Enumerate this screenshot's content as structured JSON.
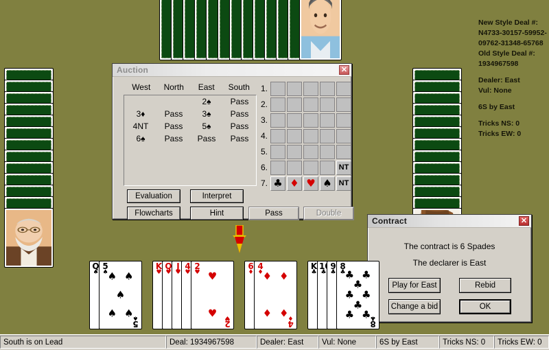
{
  "app": {
    "background_color": "#808040"
  },
  "info_panel": {
    "new_style_label": "New Style Deal #:",
    "new_style_line1": "N4733-30157-59952-",
    "new_style_line2": "09762-31348-65768",
    "old_style_label": "Old Style Deal #:",
    "old_style_value": "1934967598",
    "dealer": "Dealer: East",
    "vulnerability": "Vul: None",
    "contract": "6S by East",
    "tricks_ns": "Tricks NS: 0",
    "tricks_ew": "Tricks EW: 0"
  },
  "auction_dialog": {
    "title": "Auction",
    "close_label": "✕",
    "headers": [
      "West",
      "North",
      "East",
      "South"
    ],
    "bids": [
      [
        "",
        "",
        "2♠",
        "Pass"
      ],
      [
        "3♦",
        "Pass",
        "3♠",
        "Pass"
      ],
      [
        "4NT",
        "Pass",
        "5♠",
        "Pass"
      ],
      [
        "6♠",
        "Pass",
        "Pass",
        "Pass"
      ]
    ],
    "buttons": {
      "evaluation": "Evaluation",
      "interpret": "Interpret",
      "flowcharts": "Flowcharts",
      "hint": "Hint",
      "pass": "Pass",
      "double": "Double"
    },
    "double_enabled": false,
    "grid": {
      "row_labels": [
        "1.",
        "2.",
        "3.",
        "4.",
        "5.",
        "6.",
        "7."
      ],
      "suit_symbols": [
        "♣",
        "♦",
        "♥",
        "♠",
        "NT"
      ],
      "enabled_cells": {
        "6": [
          "NT"
        ],
        "7": [
          "♣",
          "♦",
          "♥",
          "♠",
          "NT"
        ]
      }
    }
  },
  "contract_dialog": {
    "title": "Contract",
    "close_label": "✕",
    "line1": "The contract is 6 Spades",
    "line2": "The declarer is East",
    "buttons": {
      "play_for_east": "Play for East",
      "rebid": "Rebid",
      "change_a_bid": "Change a bid",
      "ok": "OK"
    },
    "default_button": "OK"
  },
  "status_bar": {
    "message": "South is on Lead",
    "deal": "Deal: 1934967598",
    "dealer": "Dealer: East",
    "vul": "Vul: None",
    "contract": "6S by East",
    "tricks_ns": "Tricks NS: 0",
    "tricks_ew": "Tricks EW: 0"
  },
  "hands": {
    "north": {
      "facedown_count": 12,
      "has_portrait": true
    },
    "west": {
      "facedown_count": 12,
      "has_portrait": true
    },
    "east": {
      "facedown_count": 12,
      "has_portrait": true
    },
    "south": {
      "suits": [
        {
          "suit": "♠",
          "color": "black",
          "cards": [
            "Q",
            "5"
          ]
        },
        {
          "suit": "♥",
          "color": "red",
          "cards": [
            "K",
            "Q",
            "J",
            "4",
            "2"
          ]
        },
        {
          "suit": "♦",
          "color": "red",
          "cards": [
            "6",
            "4"
          ]
        },
        {
          "suit": "♣",
          "color": "black",
          "cards": [
            "K",
            "10",
            "9",
            "8"
          ]
        }
      ]
    }
  },
  "lead_indicator": {
    "direction": "south",
    "color_primary": "#d40000",
    "color_secondary": "#e8c000"
  }
}
